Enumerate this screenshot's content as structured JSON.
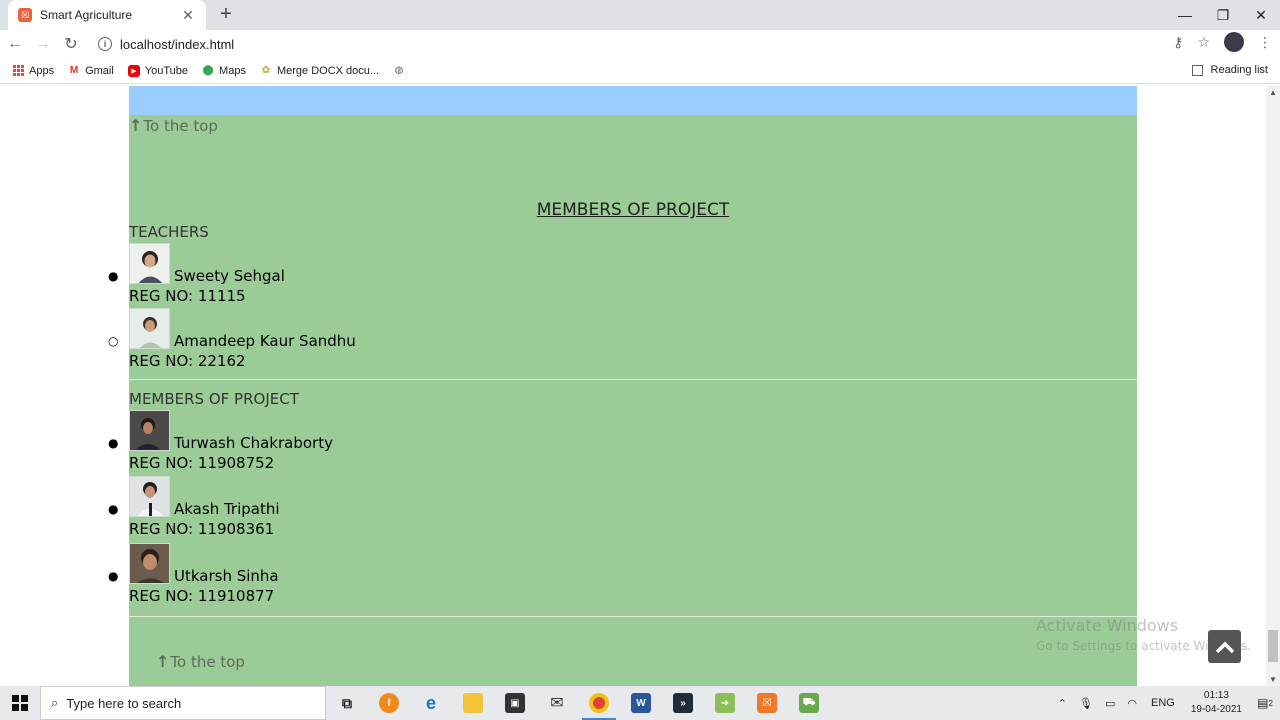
{
  "browser": {
    "tab_title": "Smart Agriculture",
    "url": "localhost/index.html",
    "bookmarks": [
      {
        "label": "Apps",
        "icon": "apps-grid-icon"
      },
      {
        "label": "Gmail",
        "icon": "gmail-icon"
      },
      {
        "label": "YouTube",
        "icon": "youtube-icon"
      },
      {
        "label": "Maps",
        "icon": "maps-icon"
      },
      {
        "label": "Merge DOCX docu...",
        "icon": "merge-docx-icon"
      }
    ],
    "reading_list": "Reading list"
  },
  "page": {
    "to_top_label": "To the top",
    "section_title": "MEMBERS OF PROJECT",
    "teachers_label": "TEACHERS",
    "teachers": [
      {
        "name": "Sweety Sehgal",
        "reg": "REG NO: 11115"
      },
      {
        "name": "Amandeep Kaur Sandhu",
        "reg": "REG NO: 22162"
      }
    ],
    "members_label": "MEMBERS OF PROJECT",
    "members": [
      {
        "name": "Turwash Chakraborty",
        "reg": "REG NO: 11908752"
      },
      {
        "name": "Akash Tripathi",
        "reg": "REG NO: 11908361"
      },
      {
        "name": "Utkarsh Sinha",
        "reg": "REG NO: 11910877"
      }
    ],
    "colors": {
      "content_bg": "#9bcc97",
      "header_band": "#99ccff"
    }
  },
  "watermark": {
    "title": "Activate Windows",
    "subtitle": "Go to Settings to activate Windows."
  },
  "taskbar": {
    "search_placeholder": "Type here to search",
    "language": "ENG",
    "time": "01:13",
    "date": "19-04-2021",
    "notification_count": "2"
  }
}
